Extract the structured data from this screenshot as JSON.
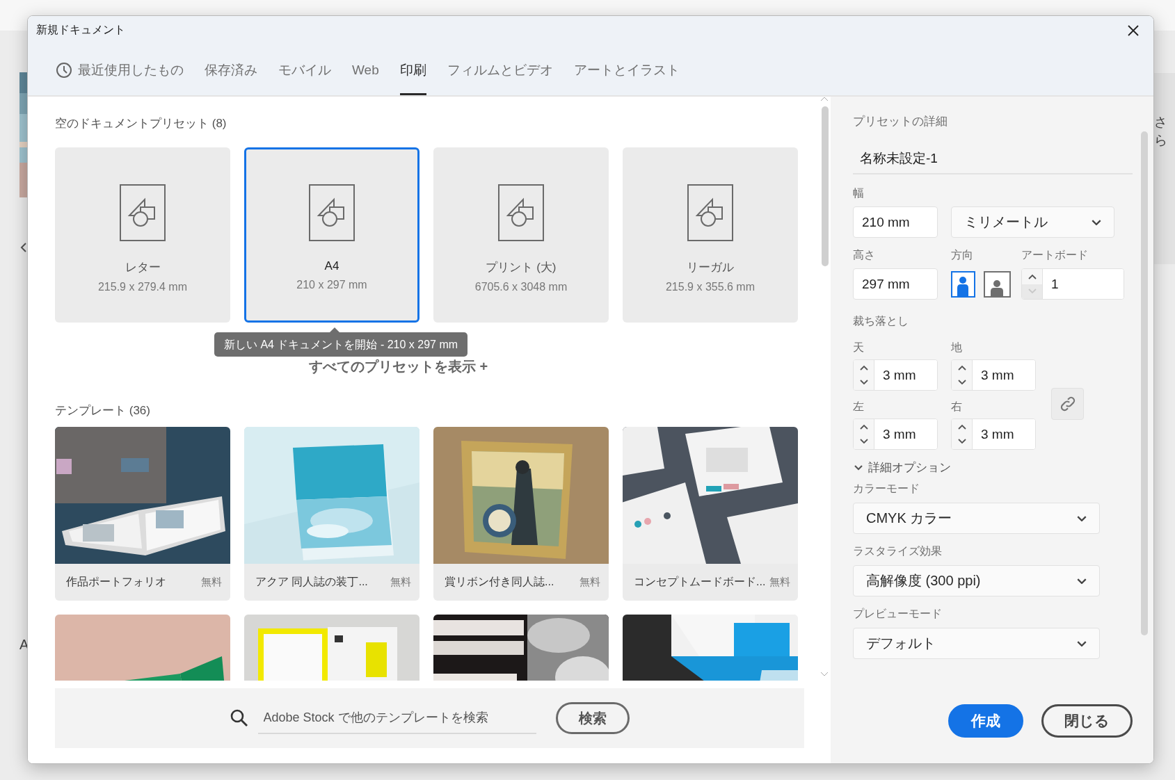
{
  "background": {
    "left_texts": [
      "A"
    ],
    "right_text": "さら"
  },
  "window": {
    "title": "新規ドキュメント"
  },
  "tabs": [
    {
      "label": "最近使用したもの",
      "selected": false,
      "kind": "recent"
    },
    {
      "label": "保存済み",
      "selected": false,
      "kind": "plain"
    },
    {
      "label": "モバイル",
      "selected": false,
      "kind": "plain"
    },
    {
      "label": "Web",
      "selected": false,
      "kind": "plain"
    },
    {
      "label": "印刷",
      "selected": true,
      "kind": "plain"
    },
    {
      "label": "フィルムとビデオ",
      "selected": false,
      "kind": "plain"
    },
    {
      "label": "アートとイラスト",
      "selected": false,
      "kind": "plain"
    }
  ],
  "presets": {
    "heading": "空のドキュメントプリセット (8)",
    "items": [
      {
        "name": "レター",
        "size": "215.9 x 279.4 mm",
        "selected": false
      },
      {
        "name": "A4",
        "size": "210 x 297 mm",
        "selected": true
      },
      {
        "name": "プリント (大)",
        "size": "6705.6 x 3048 mm",
        "selected": false
      },
      {
        "name": "リーガル",
        "size": "215.9 x 355.6 mm",
        "selected": false
      }
    ],
    "tooltip": "新しい A4 ドキュメントを開始 - 210 x 297 mm",
    "view_all": "すべてのプリセットを表示 +"
  },
  "templates": {
    "heading": "テンプレート (36)",
    "items": [
      {
        "kind": "card",
        "title": "作品ポートフォリオ",
        "price": "無料"
      },
      {
        "kind": "card",
        "title": "アクア 同人誌の装丁...",
        "price": "無料"
      },
      {
        "kind": "card",
        "title": "賞リボン付き同人誌...",
        "price": "無料"
      },
      {
        "kind": "card",
        "title": "コンセプトムードボード...",
        "price": "無料"
      },
      {
        "kind": "cut"
      },
      {
        "kind": "cut"
      },
      {
        "kind": "cut"
      },
      {
        "kind": "cut"
      }
    ]
  },
  "search": {
    "placeholder": "Adobe Stock で他のテンプレートを検索",
    "button": "検索"
  },
  "details": {
    "heading": "プリセットの詳細",
    "name": "名称未設定-1",
    "width": {
      "label": "幅",
      "value": "210 mm"
    },
    "unit": "ミリメートル",
    "height": {
      "label": "高さ",
      "value": "297 mm"
    },
    "orientation": {
      "label": "方向",
      "options": [
        {
          "kind": "portrait",
          "selected": true
        },
        {
          "kind": "landscape",
          "selected": false
        }
      ]
    },
    "artboards": {
      "label": "アートボード",
      "value": "1",
      "down_disabled": true
    },
    "bleed": {
      "label": "裁ち落とし",
      "fields": [
        {
          "label": "天",
          "value": "3 mm"
        },
        {
          "label": "地",
          "value": "3 mm"
        },
        {
          "label": "左",
          "value": "3 mm"
        },
        {
          "label": "右",
          "value": "3 mm"
        }
      ]
    },
    "advanced": {
      "label": "詳細オプション",
      "expanded": true
    },
    "selects": [
      {
        "label": "カラーモード",
        "value": "CMYK カラー"
      },
      {
        "label": "ラスタライズ効果",
        "value": "高解像度 (300 ppi)"
      },
      {
        "label": "プレビューモード",
        "value": "デフォルト"
      }
    ]
  },
  "actions": [
    {
      "label": "作成",
      "kind": "primary"
    },
    {
      "label": "閉じる",
      "kind": "secondary"
    }
  ]
}
